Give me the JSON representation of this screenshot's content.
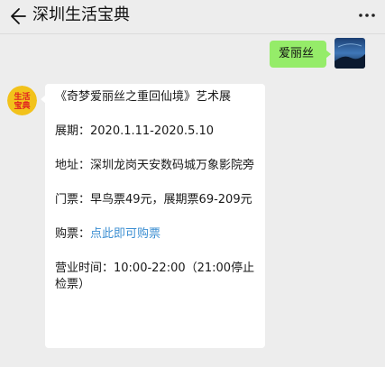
{
  "header": {
    "title": "深圳生活宝典"
  },
  "chat": {
    "outgoing": {
      "text": "爱丽丝"
    },
    "incoming": {
      "avatar_text_line1": "生活",
      "avatar_text_line2": "宝典",
      "title_line": "《奇梦爱丽丝之重回仙境》艺术展",
      "dates": "展期：2020.1.11-2020.5.10",
      "address": "地址：深圳龙岗天安数码城万象影院旁",
      "tickets": "门票：早鸟票49元，展期票69-209元",
      "purchase_prefix": "购票：",
      "purchase_link": "点此即可购票",
      "hours": "营业时间：10:00-22:00（21:00停止检票）"
    }
  },
  "colors": {
    "background": "#ededed",
    "outgoing_bubble": "#95ec69",
    "incoming_bubble": "#ffffff",
    "link": "#3d8fd2",
    "bot_avatar_bg": "#f2c21b",
    "bot_avatar_text": "#e02020"
  },
  "icons": {
    "back": "back-arrow-icon",
    "more": "more-dots-icon"
  }
}
